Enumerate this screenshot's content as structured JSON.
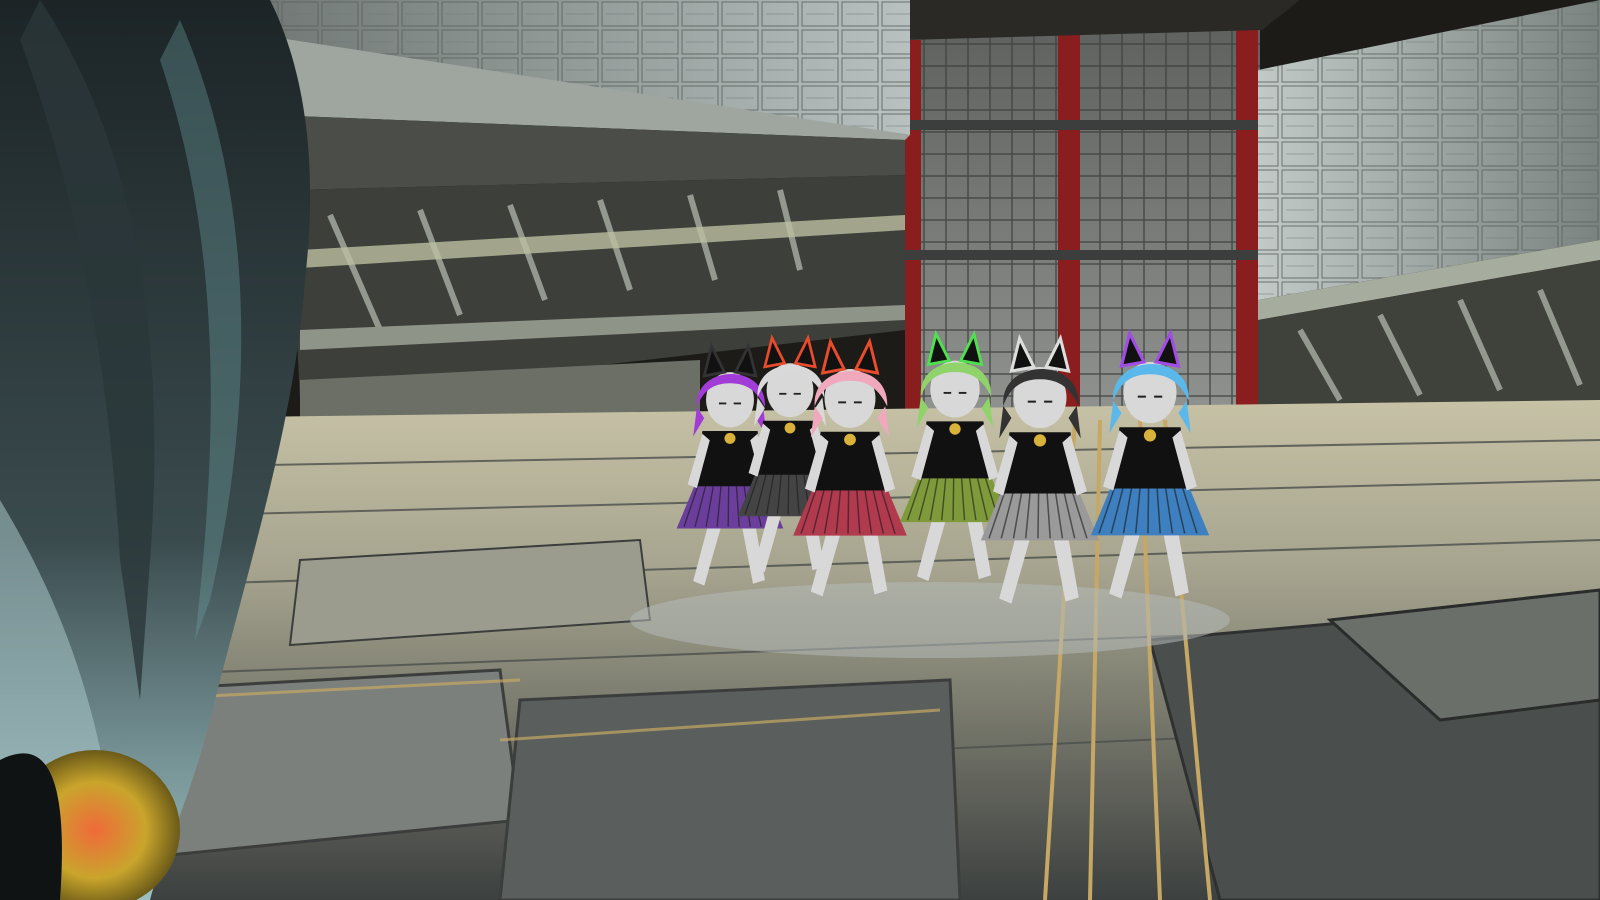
{
  "scene": {
    "type": "vr-world-first-person-view",
    "environment": "sci-fi-hangar",
    "palette": {
      "sky": "#1b1a17",
      "wall_light": "#b9c2c0",
      "wall_mid": "#8b9391",
      "wall_dark": "#5d6462",
      "floor_light": "#b8b49a",
      "floor_mid": "#8a8a7c",
      "floor_dark": "#3f4342",
      "floor_gold": "#c6a864",
      "pillar_red": "#8a1e1e",
      "tower_grey": "#6e706e",
      "skin": "#d8d8d8",
      "shirt": "#111111"
    },
    "avatars": [
      {
        "id": "purple",
        "hair": "#a23cd6",
        "ear_glow": "#333333",
        "skirt": "#6a3e9a"
      },
      {
        "id": "white",
        "hair": "#d9d9d9",
        "ear_glow": "#e84c2c",
        "skirt": "#444444"
      },
      {
        "id": "pink",
        "hair": "#f0a8bc",
        "ear_glow": "#e84c2c",
        "skirt": "#b23a4f"
      },
      {
        "id": "green",
        "hair": "#8fd36a",
        "ear_glow": "#4fe04f",
        "skirt": "#7f9a3a"
      },
      {
        "id": "black",
        "hair": "#333333",
        "ear_glow": "#dddddd",
        "skirt": "#9a9a9a"
      },
      {
        "id": "blue",
        "hair": "#5ab8ea",
        "ear_glow": "#a24ce6",
        "skirt": "#3e7fbf"
      }
    ],
    "foreground_avatar": {
      "hair": "#1f2a2c",
      "hair_tint": "#7fb0b4",
      "accent": "#c9a52c"
    }
  }
}
